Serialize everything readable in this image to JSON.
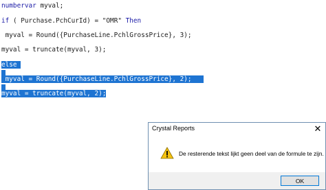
{
  "editor": {
    "lines": [
      {
        "kw": "numbervar",
        "text": " myval;"
      },
      {
        "kw": "",
        "text": ""
      },
      {
        "kw": "if",
        "text": " ( Purchase.PchCurId) = \"OMR\" ",
        "kw2": "Then"
      },
      {
        "kw": "",
        "text": ""
      },
      {
        "kw": "",
        "text": " myval = Round({PurchaseLine.PchlGrossPrice}, 3);"
      },
      {
        "kw": "",
        "text": ""
      },
      {
        "kw": "",
        "text": "myval = truncate(myval, 3);"
      },
      {
        "kw": "",
        "text": ""
      },
      {
        "kw": "else",
        "text": ""
      },
      {
        "kw": "",
        "text": ""
      },
      {
        "kw": "",
        "text": " myval = Round({PurchaseLine.PchlGrossPrice}, 2);"
      },
      {
        "kw": "",
        "text": ""
      },
      {
        "kw": "",
        "text": "myval = truncate(myval, 2);"
      }
    ],
    "selection_color": "#1e74d2",
    "keyword_color": "#1a1aa6"
  },
  "dialog": {
    "title": "Crystal Reports",
    "message": "De resterende tekst lijkt geen deel van de formule te zijn.",
    "ok_label": "OK",
    "icon": "warning-icon",
    "close_glyph": "✕"
  }
}
